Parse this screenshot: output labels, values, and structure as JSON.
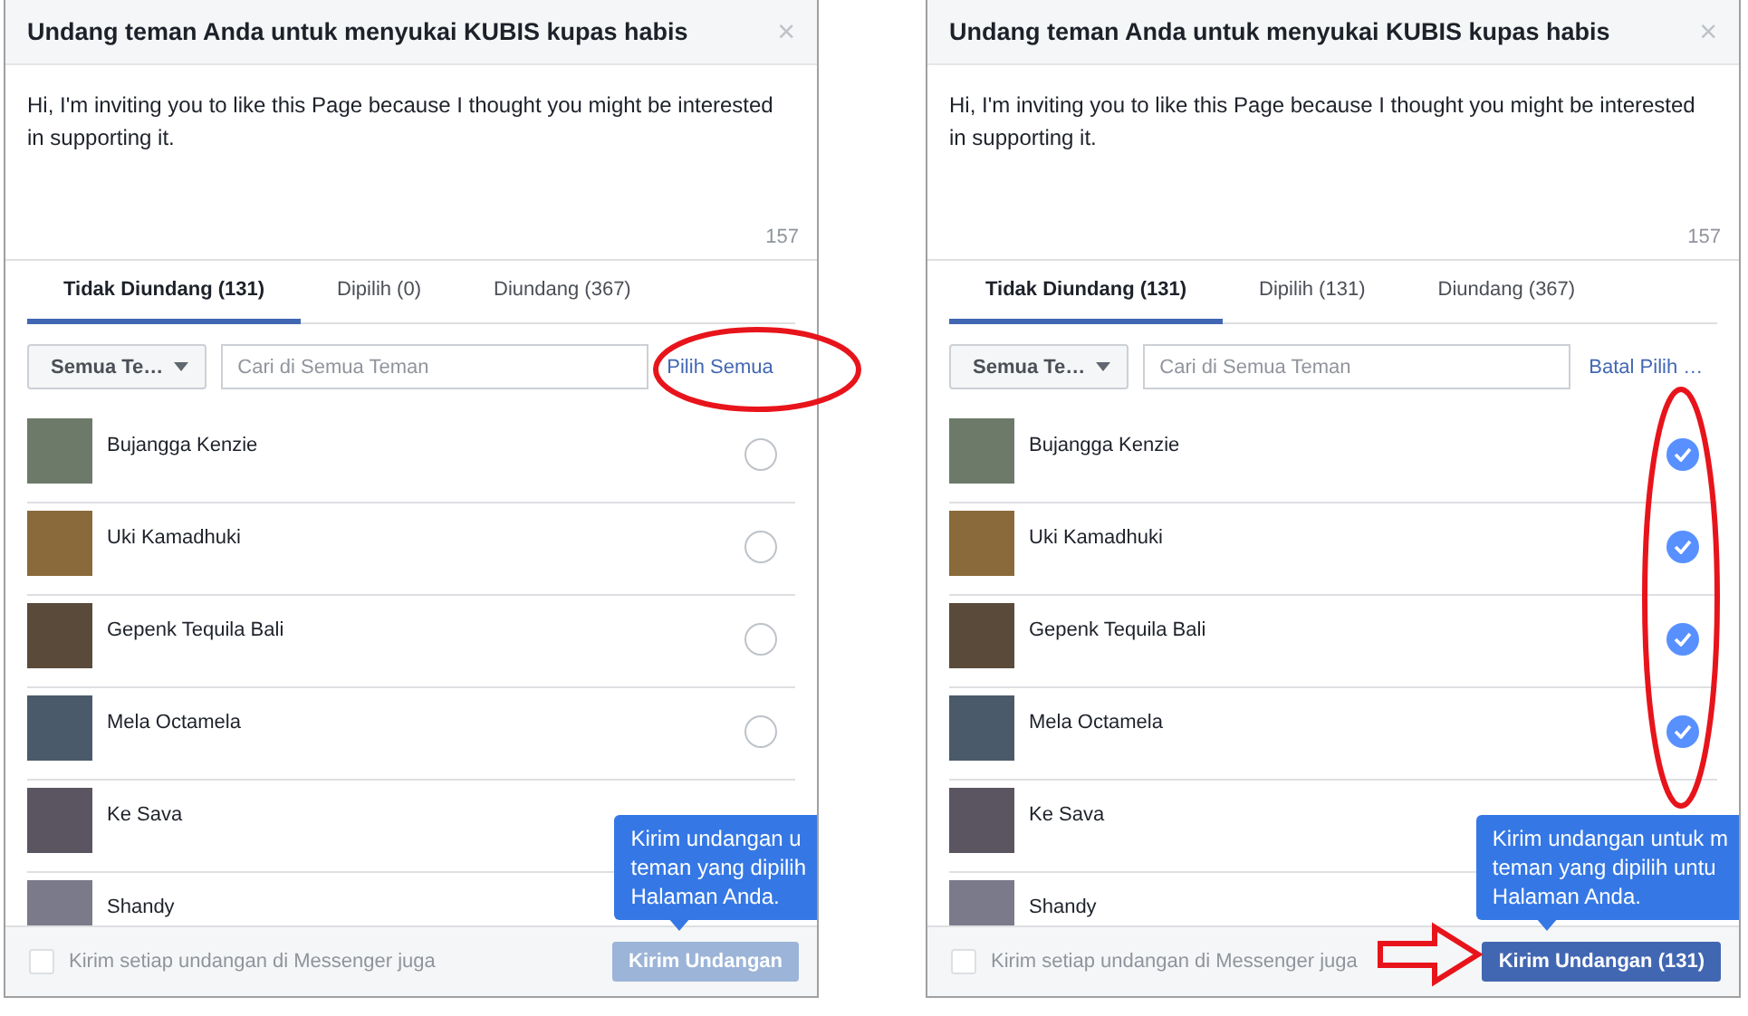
{
  "panels": [
    {
      "title": "Undang teman Anda untuk menyukai KUBIS kupas habis",
      "close": "×",
      "message": "Hi, I'm inviting you to like this Page because I thought you might be interested in supporting it.",
      "char_count": "157",
      "tabs": [
        {
          "label": "Tidak Diundang (131)",
          "selected": true
        },
        {
          "label": "Dipilih (0)",
          "selected": false
        },
        {
          "label": "Diundang (367)",
          "selected": false
        }
      ],
      "filter": "Semua Te…",
      "search_placeholder": "Cari di Semua Teman",
      "select_link": "Pilih Semua",
      "friends": [
        {
          "name": "Bujangga Kenzie",
          "selected": false
        },
        {
          "name": "Uki Kamadhuki",
          "selected": false
        },
        {
          "name": "Gepenk Tequila Bali",
          "selected": false
        },
        {
          "name": "Mela Octamela",
          "selected": false
        },
        {
          "name": "Ke Sava"
        },
        {
          "name": "Shandy"
        }
      ],
      "tooltip_lines": [
        "Kirim undangan u",
        "teman yang dipilih",
        "Halaman Anda."
      ],
      "messenger_option": {
        "label": "Kirim setiap undangan di Messenger juga",
        "checked": false
      },
      "send_button": {
        "label": "Kirim Undangan",
        "disabled": true
      },
      "annotations": [
        {
          "kind": "select-link-ellipse"
        }
      ]
    },
    {
      "title": "Undang teman Anda untuk menyukai KUBIS kupas habis",
      "close": "×",
      "message": "Hi, I'm inviting you to like this Page because I thought you might be interested in supporting it.",
      "char_count": "157",
      "tabs": [
        {
          "label": "Tidak Diundang (131)",
          "selected": true
        },
        {
          "label": "Dipilih (131)",
          "selected": false
        },
        {
          "label": "Diundang (367)",
          "selected": false
        }
      ],
      "filter": "Semua Te…",
      "search_placeholder": "Cari di Semua Teman",
      "select_link": "Batal Pilih …",
      "friends": [
        {
          "name": "Bujangga Kenzie",
          "selected": true
        },
        {
          "name": "Uki Kamadhuki",
          "selected": true
        },
        {
          "name": "Gepenk Tequila Bali",
          "selected": true
        },
        {
          "name": "Mela Octamela",
          "selected": true
        },
        {
          "name": "Ke Sava"
        },
        {
          "name": "Shandy"
        }
      ],
      "tooltip_lines": [
        "Kirim undangan untuk m",
        "teman yang dipilih untu",
        "Halaman Anda."
      ],
      "messenger_option": {
        "label": "Kirim setiap undangan di Messenger juga",
        "checked": false
      },
      "send_button": {
        "label": "Kirim Undangan (131)",
        "disabled": false
      },
      "annotations": [
        {
          "kind": "checks-ellipse"
        },
        {
          "kind": "send-arrow"
        }
      ]
    }
  ]
}
